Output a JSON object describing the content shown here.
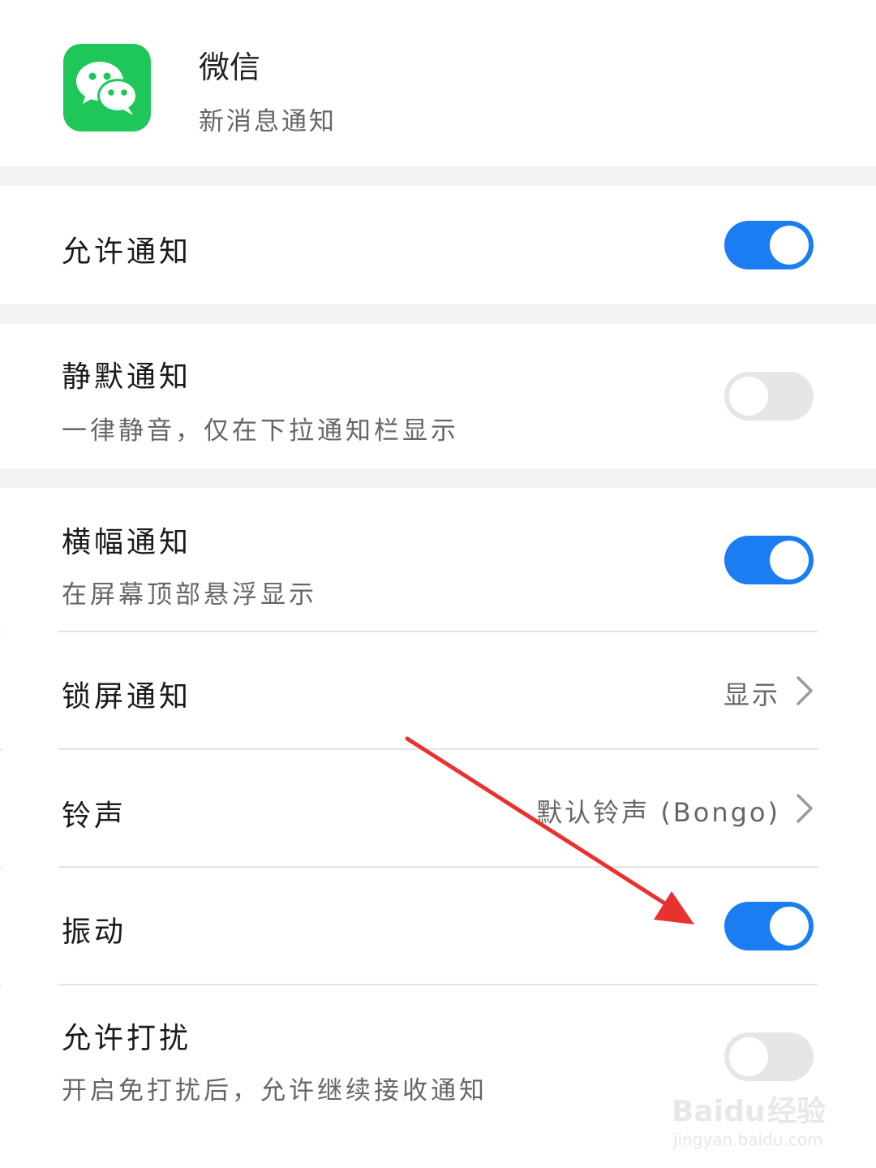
{
  "app": {
    "name": "微信",
    "subtitle": "新消息通知",
    "icon": "wechat-icon",
    "icon_color": "#1fc65a"
  },
  "settings": [
    {
      "title": "允许通知",
      "toggle": true
    },
    {
      "title": "静默通知",
      "subtitle": "一律静音，仅在下拉通知栏显示",
      "toggle": false
    },
    {
      "title": "横幅通知",
      "subtitle": "在屏幕顶部悬浮显示",
      "toggle": true
    },
    {
      "title": "锁屏通知",
      "value": "显示"
    },
    {
      "title": "铃声",
      "value": "默认铃声 (Bongo)"
    },
    {
      "title": "振动",
      "toggle": true
    },
    {
      "title": "允许打扰",
      "subtitle": "开启免打扰后，允许继续接收通知",
      "toggle": false
    }
  ],
  "colors": {
    "toggle_on": "#1a7df2",
    "toggle_off": "#e6e6e6",
    "annotation_arrow": "#e8322f"
  },
  "watermark": {
    "brand": "Baidu",
    "brand_cn": "经验",
    "url": "jingyan.baidu.com"
  }
}
